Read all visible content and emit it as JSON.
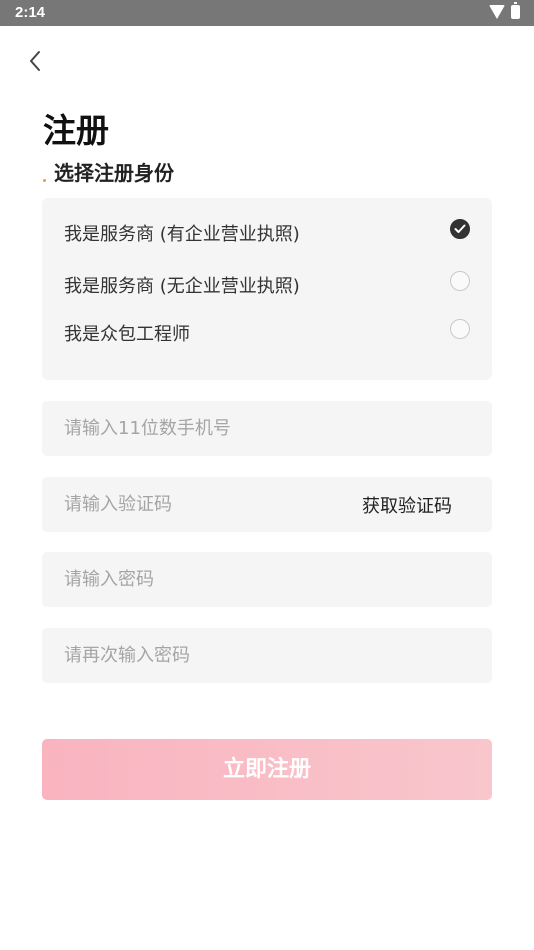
{
  "status_bar": {
    "time": "2:14"
  },
  "page": {
    "title": "注册",
    "section_label": "选择注册身份"
  },
  "identity_options": [
    {
      "label": "我是服务商 (有企业营业执照)",
      "checked": true
    },
    {
      "label": "我是服务商 (无企业营业执照)",
      "checked": false
    },
    {
      "label": "我是众包工程师",
      "checked": false
    }
  ],
  "form": {
    "phone_placeholder": "请输入11位数手机号",
    "code_placeholder": "请输入验证码",
    "get_code_label": "获取验证码",
    "password_placeholder": "请输入密码",
    "confirm_password_placeholder": "请再次输入密码",
    "submit_label": "立即注册"
  },
  "colors": {
    "submit_bg": "#f9b4c0",
    "field_bg": "#f5f5f5",
    "status_bar_bg": "#777777",
    "accent_dot": "#f09a3a"
  }
}
